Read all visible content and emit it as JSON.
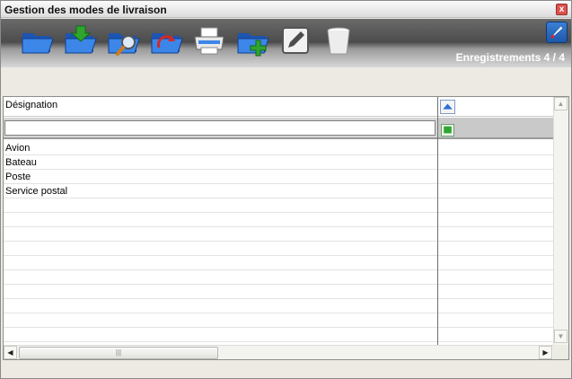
{
  "window": {
    "title": "Gestion des modes de livraison",
    "close_label": "x"
  },
  "toolbar": {
    "buttons": [
      {
        "name": "open-folder",
        "icon": "folder-icon"
      },
      {
        "name": "import",
        "icon": "folder-arrow-icon"
      },
      {
        "name": "search",
        "icon": "folder-search-icon"
      },
      {
        "name": "refresh",
        "icon": "folder-refresh-icon"
      },
      {
        "name": "print",
        "icon": "printer-icon"
      },
      {
        "name": "add",
        "icon": "folder-add-icon"
      },
      {
        "name": "edit",
        "icon": "pencil-icon"
      },
      {
        "name": "delete",
        "icon": "trash-icon"
      }
    ],
    "records_label": "Enregistrements 4 / 4"
  },
  "grid": {
    "column_header": "Désignation",
    "filter_value": "",
    "rows": [
      "Avion",
      "Bateau",
      "Poste",
      "Service postal"
    ],
    "hthumb_grip": "|||"
  },
  "colors": {
    "toolbar_dark": "#4c4c4c",
    "folder_blue": "#2b6fd6",
    "accent_green": "#2fa52f"
  }
}
